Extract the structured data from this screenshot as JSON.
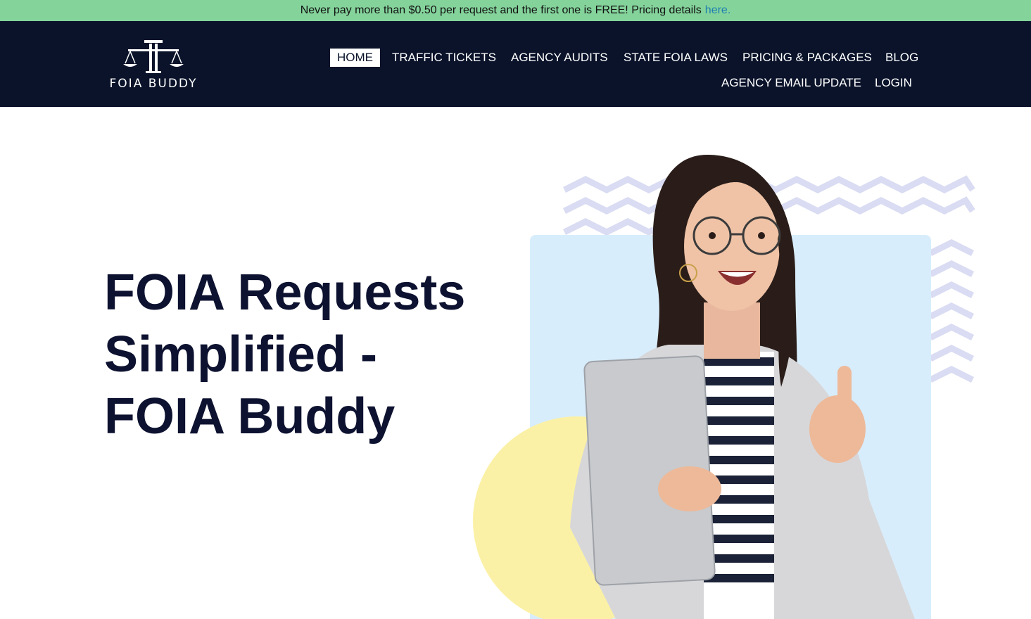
{
  "announcement": {
    "text": "Never pay more than $0.50 per request and the first one is FREE! Pricing details",
    "link_label": "here."
  },
  "brand": {
    "name": "FOIA BUDDY"
  },
  "nav": {
    "home": "HOME",
    "traffic_tickets": "TRAFFIC TICKETS",
    "agency_audits": "AGENCY AUDITS",
    "state_foia_laws": "STATE FOIA LAWS",
    "pricing_packages": "PRICING & PACKAGES",
    "blog": "BLOG",
    "agency_email_update": "AGENCY EMAIL UPDATE",
    "login": "LOGIN"
  },
  "hero": {
    "line1": "FOIA Requests",
    "line2": "Simplified -",
    "line3": "FOIA Buddy"
  },
  "colors": {
    "announcement_bg": "#84d39b",
    "header_bg": "#0a132a",
    "link": "#1f7fb0",
    "hero_text": "#0d1230",
    "panel_blue": "#d8edfb",
    "circle_yellow": "#fbf1a6",
    "zigzag": "#d9dcf2"
  },
  "icons": {
    "logo": "scales-of-justice-icon"
  }
}
